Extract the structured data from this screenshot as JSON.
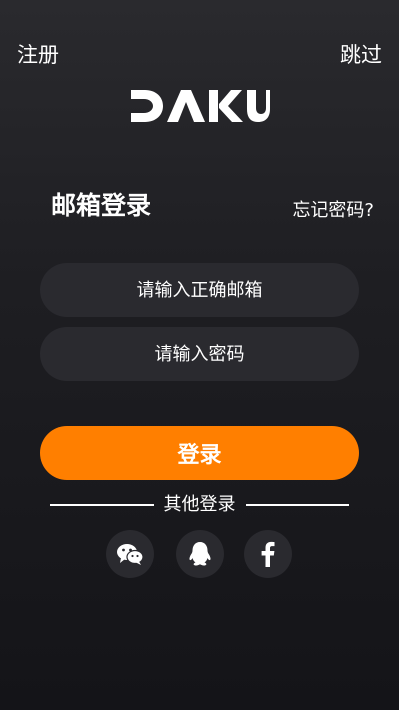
{
  "header": {
    "register_label": "注册",
    "skip_label": "跳过"
  },
  "brand": {
    "logo_text": "DAKU"
  },
  "login": {
    "title": "邮箱登录",
    "forgot_label": "忘记密码?",
    "email_placeholder": "请输入正确邮箱",
    "email_value": "",
    "password_placeholder": "请输入密码",
    "password_value": "",
    "submit_label": "登录"
  },
  "other_login": {
    "label": "其他登录",
    "providers": [
      {
        "name": "wechat",
        "icon": "wechat-icon"
      },
      {
        "name": "qq",
        "icon": "qq-icon"
      },
      {
        "name": "facebook",
        "icon": "facebook-icon"
      }
    ]
  },
  "colors": {
    "accent": "#ff7f00",
    "field_bg": "#2a2a2f",
    "text": "#ffffff"
  }
}
